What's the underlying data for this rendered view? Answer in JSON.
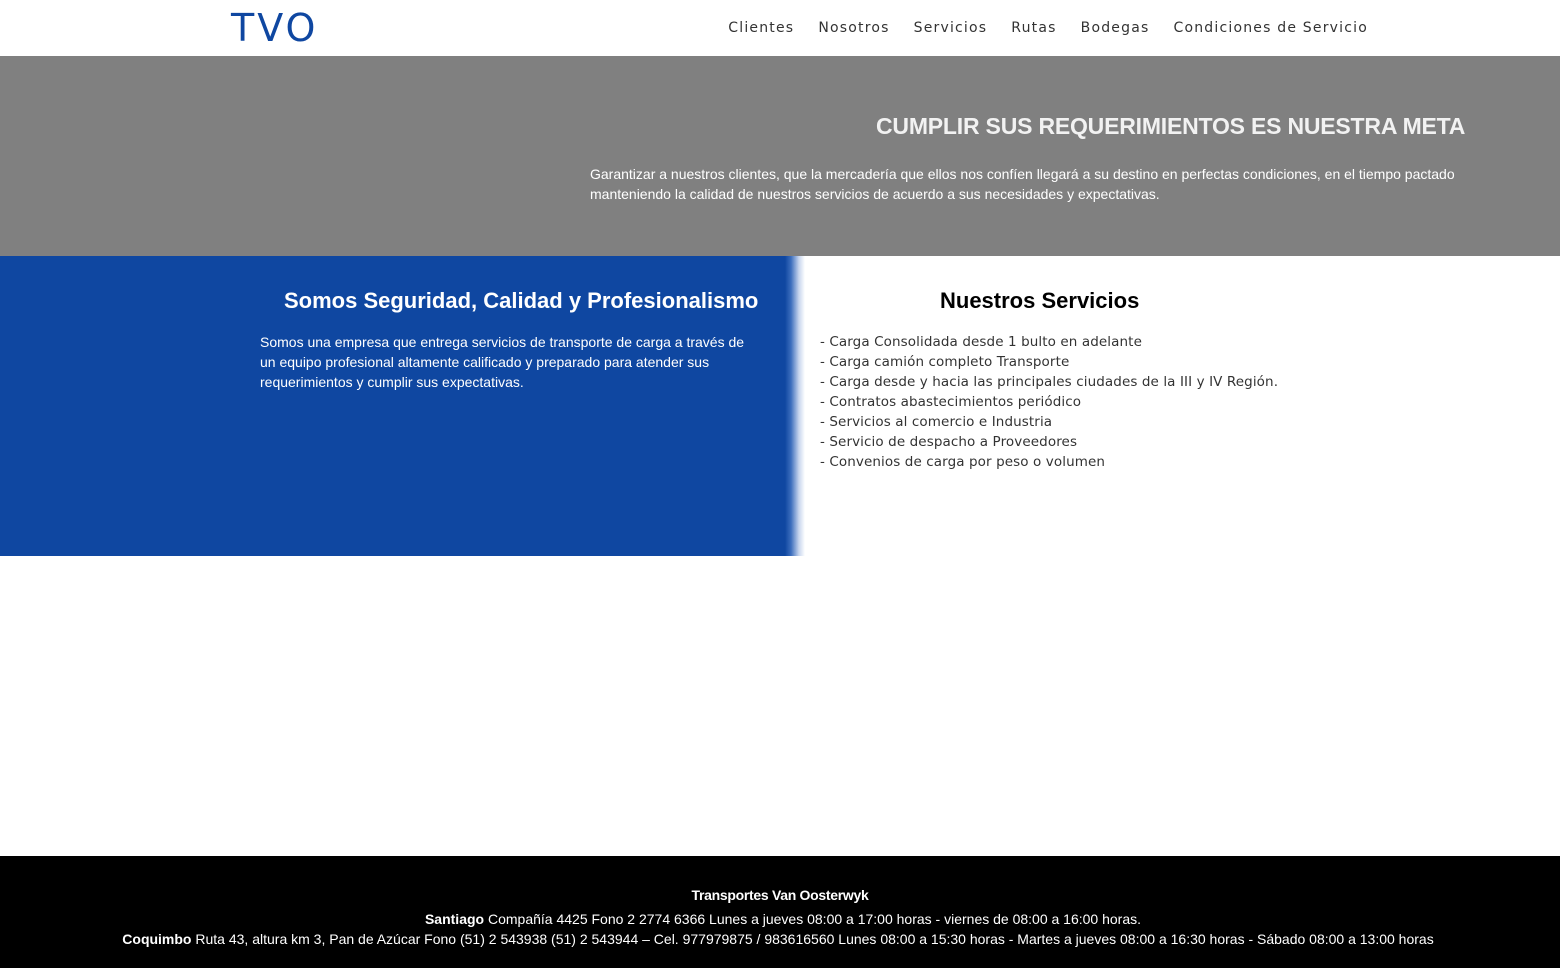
{
  "header": {
    "logo": "TVO",
    "nav": [
      "Clientes",
      "Nosotros",
      "Servicios",
      "Rutas",
      "Bodegas",
      "Condiciones de Servicio"
    ]
  },
  "hero": {
    "title": "CUMPLIR SUS REQUERIMIENTOS ES NUESTRA META",
    "text": "Garantizar a nuestros clientes, que la mercadería que ellos nos confíen llegará a su destino en perfectas condiciones, en el tiempo pactado manteniendo la calidad de nuestros servicios de acuerdo a sus necesidades y expectativas."
  },
  "about": {
    "title": "Somos Seguridad, Calidad y Profesionalismo",
    "text": "Somos una empresa que entrega servicios de transporte de carga a través de un equipo profesional altamente calificado y preparado para atender sus requerimientos y cumplir sus expectativas."
  },
  "services": {
    "title": "Nuestros Servicios",
    "items": [
      "- Carga Consolidada desde 1 bulto en adelante",
      "- Carga camión completo Transporte",
      "- Carga desde y hacia las principales ciudades de la III y IV Región.",
      "- Contratos abastecimientos periódico",
      "- Servicios al comercio e Industria",
      "- Servicio de despacho a Proveedores",
      "- Convenios de carga por peso o volumen"
    ]
  },
  "footer": {
    "company": "Transportes Van Oosterwyk",
    "santiago_label": "Santiago",
    "santiago_text": " Compañía 4425 Fono 2 2774 6366 Lunes a jueves 08:00 a 17:00 horas - viernes de 08:00 a 16:00 horas.",
    "coquimbo_label": "Coquimbo",
    "coquimbo_text": " Ruta 43, altura km 3, Pan de Azúcar Fono (51) 2 543938 (51) 2 543944 – Cel. 977979875 / 983616560 Lunes 08:00 a 15:30 horas - Martes a jueves 08:00 a 16:30 horas - Sábado 08:00 a 13:00 horas"
  },
  "colors": {
    "brand_blue": "#0f47a1",
    "hero_gray": "#808080",
    "footer_black": "#000000"
  }
}
